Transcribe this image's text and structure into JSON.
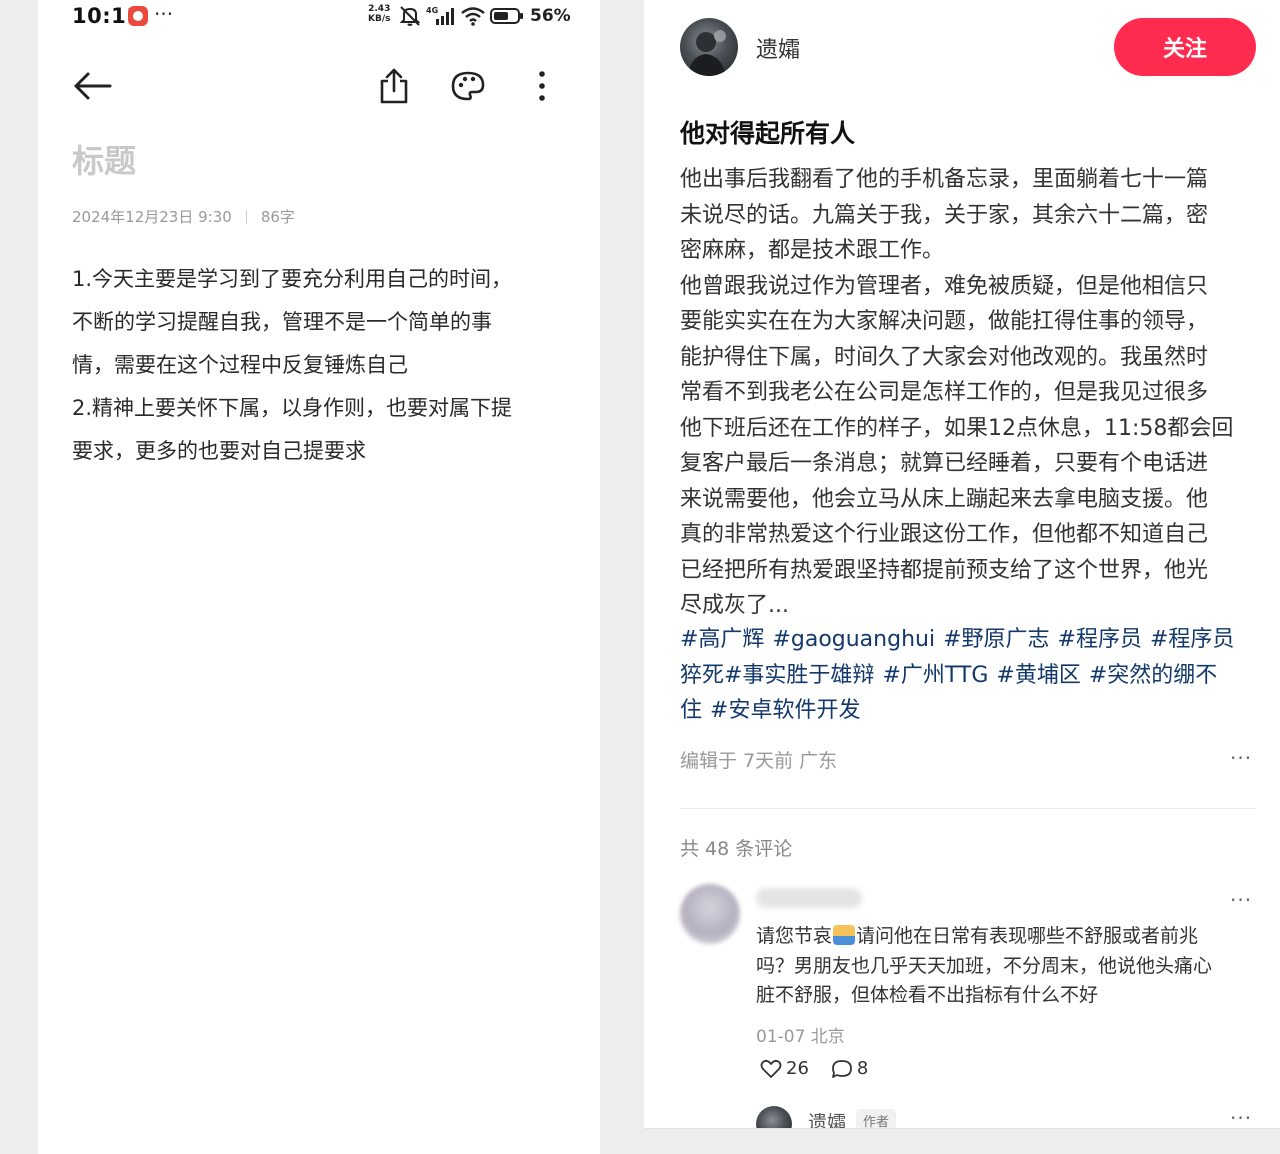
{
  "left_app": {
    "status_bar": {
      "time": "10:11",
      "more": "···",
      "net_speed_value": "2.43",
      "net_speed_unit": "KB/s",
      "network": "4G",
      "battery": "56%"
    },
    "toolbar": {
      "back_icon": "arrow-left-icon",
      "share_icon": "share-icon",
      "theme_icon": "palette-icon",
      "more_icon": "more-vertical-icon"
    },
    "note": {
      "title_placeholder": "标题",
      "date": "2024年12月23日 9:30",
      "word_count": "86字",
      "body": "1.今天主要是学习到了要充分利用自己的时间，不断的学习提醒自我，管理不是一个简单的事情，需要在这个过程中反复锤炼自己 2.精神上要关怀下属，以身作则，也要对属下提要求，更多的也要对自己提要求",
      "lines": [
        "1.今天主要是学习到了要充分利用自己的时间，",
        "不断的学习提醒自我，管理不是一个简单的事",
        "情，需要在这个过程中反复锤炼自己",
        "2.精神上要关怀下属，以身作则，也要对属下提",
        "要求，更多的也要对自己提要求"
      ]
    }
  },
  "right_app": {
    "author": {
      "name": "遗孀",
      "follow_label": "关注"
    },
    "post": {
      "title": "他对得起所有人",
      "body_lines": [
        "他出事后我翻看了他的手机备忘录，里面躺着七十一篇",
        "未说尽的话。九篇关于我，关于家，其余六十二篇，密",
        "密麻麻，都是技术跟工作。",
        "他曾跟我说过作为管理者，难免被质疑，但是他相信只",
        "要能实实在在为大家解决问题，做能扛得住事的领导，",
        "能护得住下属，时间久了大家会对他改观的。我虽然时",
        "常看不到我老公在公司是怎样工作的，但是我见过很多",
        "他下班后还在工作的样子，如果12点休息，11:58都会回",
        "复客户最后一条消息；就算已经睡着，只要有个电话进",
        "来说需要他，他会立马从床上蹦起来去拿电脑支援。他",
        "真的非常热爱这个行业跟这份工作，但他都不知道自己",
        "已经把所有热爱跟坚持都提前预支给了这个世界，他光",
        "尽成灰了..."
      ],
      "tag_lines": [
        [
          "#高广辉",
          "#gaoguanghui",
          "#野原广志",
          "#程序员",
          "#程序员"
        ],
        [
          "猝死#事实胜于雄辩",
          "#广州TTG",
          "#黄埔区",
          "#突然的绷不"
        ],
        [
          "住",
          "#安卓软件开发"
        ]
      ],
      "meta": "编辑于 7天前 广东",
      "more": "···"
    },
    "comments": {
      "count_label": "共 48 条评论",
      "items": [
        {
          "text_before_emoji": "请您节哀",
          "emoji_icon": "sad-emoji-icon",
          "text_lines": [
            "请问他在日常有表现哪些不舒服或者前兆",
            "吗？男朋友也几乎天天加班，不分周末，他说他头痛心",
            "脏不舒服，但体检看不出指标有什么不好"
          ],
          "meta": "01-07 北京",
          "likes": "26",
          "replies": "8",
          "more": "···"
        }
      ],
      "reply": {
        "name": "遗孀",
        "badge": "作者",
        "more": "···"
      }
    }
  }
}
